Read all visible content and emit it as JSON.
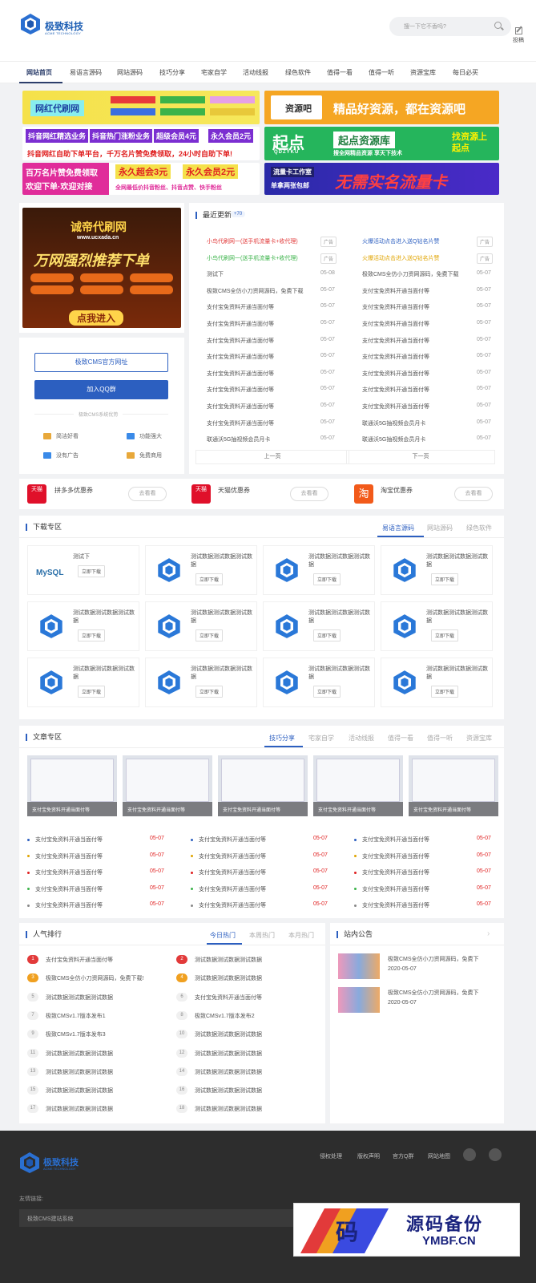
{
  "header": {
    "logo_title": "极致科技",
    "logo_subtitle": "ACME TECHNOLOGY",
    "search_placeholder": "搜一下它不香吗?",
    "contribute_label": "投稿"
  },
  "nav": [
    "网站首页",
    "易语言源码",
    "网站源码",
    "技巧分享",
    "宅家自学",
    "活动线报",
    "绿色软件",
    "值得一看",
    "值得一听",
    "资源宝库",
    "每日必买"
  ],
  "ads": {
    "a1": "网红代刷网",
    "a2": "资源吧",
    "a2b": "精品好资源，都在资源吧",
    "a3": [
      "抖音网红精选业务",
      "抖音热门涨粉业务",
      "超级会员4元",
      "永久会员2元"
    ],
    "a3b": "抖音网红自助下单平台，千万名片赞免费领取，24小时自助下单!",
    "a4": "起点",
    "a4sub": "QDZYKU",
    "a4b": "起点资源库",
    "a4c": "找资源上起点",
    "a4d": "搜全网精品资源 享天下技术",
    "a5": [
      "百万名片赞免费领取",
      "欢迎下单·欢迎对接",
      "永久超会3元",
      "永久会员2元",
      "全网最低价抖音粉丝、抖音点赞、快手粉丝"
    ],
    "a6": "流量卡工作室",
    "a6b": "无需实名流量卡",
    "a6c": "单拿两张包邮",
    "side_title": "诚帝代刷网",
    "side_url": "www.ucxada.cn",
    "side_slogan": "万网强烈推荐下单",
    "side_btn": "点我进入"
  },
  "sidebar_box": {
    "btn_official": "极致CMS官方网址",
    "btn_qq": "加入QQ群",
    "divider": "极致CMS系统优势",
    "features": [
      "简洁好看",
      "功能强大",
      "没有广告",
      "免费商用"
    ]
  },
  "recent": {
    "title": "最近更新",
    "badge": "+70",
    "col1": [
      {
        "t": "小鸟代刷网一(送手机流量卡+收代理)",
        "d": "广告",
        "c": "#e23b3b"
      },
      {
        "t": "小鸟代刷网一(送手机流量卡+收代理)",
        "d": "广告",
        "c": "#3bb34a"
      },
      {
        "t": "测试下",
        "d": "05-08"
      },
      {
        "t": "极致CMS全仿小刀资网源码，免费下载",
        "d": "05-07"
      },
      {
        "t": "支付宝免资料开通当面付等",
        "d": "05-07"
      },
      {
        "t": "支付宝免资料开通当面付等",
        "d": "05-07"
      },
      {
        "t": "支付宝免资料开通当面付等",
        "d": "05-07"
      },
      {
        "t": "支付宝免资料开通当面付等",
        "d": "05-07"
      },
      {
        "t": "支付宝免资料开通当面付等",
        "d": "05-07"
      },
      {
        "t": "支付宝免资料开通当面付等",
        "d": "05-07"
      },
      {
        "t": "支付宝免资料开通当面付等",
        "d": "05-07"
      },
      {
        "t": "支付宝免资料开通当面付等",
        "d": "05-07"
      },
      {
        "t": "联通沃5G抽视频会员月卡",
        "d": "05-07"
      }
    ],
    "col2": [
      {
        "t": "火爆活动点击进入送Q钻名片赞",
        "d": "广告",
        "c": "#2c5fc0"
      },
      {
        "t": "火爆活动点击进入送Q钻名片赞",
        "d": "广告",
        "c": "#e0a400"
      },
      {
        "t": "极致CMS全仿小刀资网源码，免费下载",
        "d": "05-07"
      },
      {
        "t": "支付宝免资料开通当面付等",
        "d": "05-07"
      },
      {
        "t": "支付宝免资料开通当面付等",
        "d": "05-07"
      },
      {
        "t": "支付宝免资料开通当面付等",
        "d": "05-07"
      },
      {
        "t": "支付宝免资料开通当面付等",
        "d": "05-07"
      },
      {
        "t": "支付宝免资料开通当面付等",
        "d": "05-07"
      },
      {
        "t": "支付宝免资料开通当面付等",
        "d": "05-07"
      },
      {
        "t": "支付宝免资料开通当面付等",
        "d": "05-07"
      },
      {
        "t": "支付宝免资料开通当面付等",
        "d": "05-07"
      },
      {
        "t": "联通沃5G抽视频会员月卡",
        "d": "05-07"
      },
      {
        "t": "联通沃5G抽视频会员月卡",
        "d": "05-07"
      }
    ],
    "prev": "上一页",
    "next": "下一页"
  },
  "coupons": [
    {
      "logo": "天猫",
      "name": "拼多多优惠券",
      "btn": "去看看"
    },
    {
      "logo": "天猫",
      "name": "天猫优惠券",
      "btn": "去看看"
    },
    {
      "logo": "淘",
      "name": "淘宝优惠券",
      "btn": "去看看"
    }
  ],
  "downloads": {
    "title": "下载专区",
    "tabs": [
      "易语言源码",
      "网站源码",
      "绿色软件"
    ],
    "btn": "立即下载",
    "first_title": "测试下",
    "mysql": "MySQL",
    "item_title": "测试数据测试数据测试数据"
  },
  "articles": {
    "title": "文章专区",
    "tabs": [
      "技巧分享",
      "宅家自学",
      "活动线报",
      "值得一看",
      "值得一听",
      "资源宝库"
    ],
    "caption": "支付宝免资料开通当面付等",
    "row_title": "支付宝免资料开通当面付等",
    "row_date": "05-07"
  },
  "ranking": {
    "title": "人气排行",
    "tabs": [
      "今日热门",
      "本周热门",
      "本月热门"
    ],
    "left": [
      {
        "n": "1",
        "t": "支付宝免资料开通当面付等"
      },
      {
        "n": "3",
        "t": "极致CMS全仿小刀资网源码，免费下载!"
      },
      {
        "n": "5",
        "t": "测试数据测试数据测试数据"
      },
      {
        "n": "7",
        "t": "极致CMSv1.7版本发布1"
      },
      {
        "n": "9",
        "t": "极致CMSv1.7版本发布3"
      },
      {
        "n": "11",
        "t": "测试数据测试数据测试数据"
      },
      {
        "n": "13",
        "t": "测试数据测试数据测试数据"
      },
      {
        "n": "15",
        "t": "测试数据测试数据测试数据"
      },
      {
        "n": "17",
        "t": "测试数据测试数据测试数据"
      }
    ],
    "right": [
      {
        "n": "2",
        "t": "测试数据测试数据测试数据"
      },
      {
        "n": "4",
        "t": "测试数据测试数据测试数据"
      },
      {
        "n": "6",
        "t": "支付宝免资料开通当面付等"
      },
      {
        "n": "8",
        "t": "极致CMSv1.7版本发布2"
      },
      {
        "n": "10",
        "t": "测试数据测试数据测试数据"
      },
      {
        "n": "12",
        "t": "测试数据测试数据测试数据"
      },
      {
        "n": "14",
        "t": "测试数据测试数据测试数据"
      },
      {
        "n": "16",
        "t": "测试数据测试数据测试数据"
      },
      {
        "n": "18",
        "t": "测试数据测试数据测试数据"
      }
    ]
  },
  "notice": {
    "title": "站内公告",
    "items": [
      {
        "t": "极致CMS全仿小刀资网源码，免费下",
        "d": "2020-05-07"
      },
      {
        "t": "极致CMS全仿小刀资网源码，免费下",
        "d": "2020-05-07"
      }
    ]
  },
  "footer": {
    "logo_title": "极致科技",
    "logo_subtitle": "ACME TECHNOLOGY",
    "links": [
      "侵权处理",
      "版权声明",
      "官方Q群",
      "网站地图"
    ],
    "friend_label": "友情链接:",
    "friend_item": "极致CMS建站系统"
  },
  "watermark": {
    "char": "码",
    "title": "源码备份",
    "domain": "YMBF.CN"
  }
}
